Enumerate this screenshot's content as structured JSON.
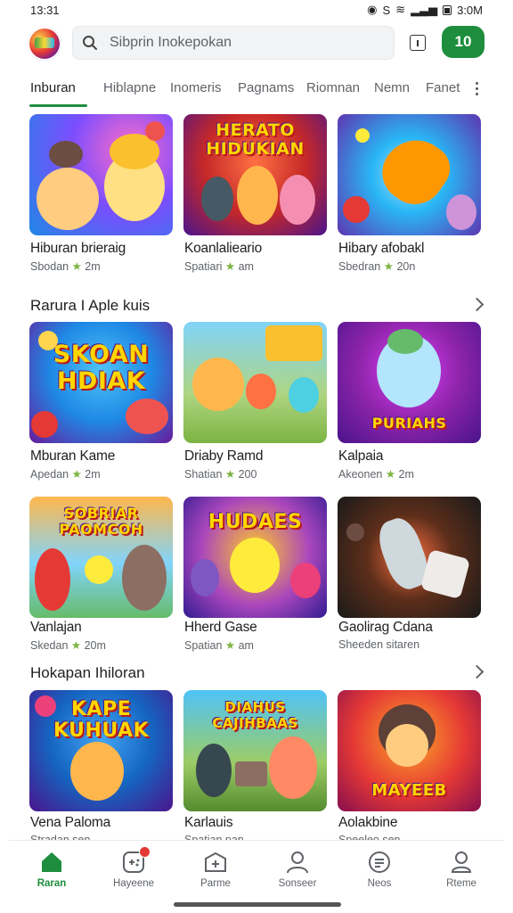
{
  "status_bar": {
    "time": "13:31",
    "right_text": "3:0M"
  },
  "header": {
    "search_placeholder": "Sibprin Inokepokan",
    "green_button_label": "10"
  },
  "tabs": [
    {
      "label": "Inburan",
      "active": true
    },
    {
      "label": "Hiblapne"
    },
    {
      "label": "Inomeris"
    },
    {
      "label": "Pagnams"
    },
    {
      "label": "Riomnan"
    },
    {
      "label": "Nemn"
    },
    {
      "label": "Fanet"
    }
  ],
  "row1": [
    {
      "title": "Hiburan brieraig",
      "meta_left": "Sbodan",
      "meta_right": "2m"
    },
    {
      "title": "Koanlalieario",
      "meta_left": "Spatiari",
      "meta_right": "am",
      "thumb_text": "HERATO HIDUKIAN"
    },
    {
      "title": "Hibary afobakl",
      "meta_left": "Sbedran",
      "meta_right": "20n"
    }
  ],
  "section2": {
    "title": "Rarura I Aple kuis"
  },
  "row2": [
    {
      "title": "Mburan Kame",
      "meta_left": "Apedan",
      "meta_right": "2m",
      "thumb_text": "SKOAN HDIAK"
    },
    {
      "title": "Driaby Ramd",
      "meta_left": "Shatian",
      "meta_right": "200"
    },
    {
      "title": "Kalpaia",
      "meta_left": "Akeonen",
      "meta_right": "2m",
      "thumb_text": "PURIAHS"
    }
  ],
  "row3": [
    {
      "title": "Vanlajan",
      "meta_left": "Skedan",
      "meta_right": "20m",
      "thumb_text": "SOBRIAR PAOMCOH"
    },
    {
      "title": "Hherd Gase",
      "meta_left": "Spatian",
      "meta_right": "am",
      "thumb_text": "HUDAES"
    },
    {
      "title": "Gaolirag Cdana",
      "meta_left": "Sheeden",
      "meta_right": "sitaren"
    }
  ],
  "section3": {
    "title": "Hokapan Ihiloran"
  },
  "row4": [
    {
      "title": "Vena Paloma",
      "meta_left": "Stradan",
      "meta_right": "sen",
      "thumb_text": "KAPE KUHUAK"
    },
    {
      "title": "Karlauis",
      "meta_left": "Spatian",
      "meta_right": "pan",
      "thumb_text": "DIAHUS CAJIHBAAS"
    },
    {
      "title": "Aolakbine",
      "meta_left": "Speeleo",
      "meta_right": "sen",
      "thumb_text": "MAYEEB"
    }
  ],
  "bottom_nav": [
    {
      "label": "Raran",
      "icon": "home-icon",
      "active": true
    },
    {
      "label": "Hayeene",
      "icon": "games-icon",
      "badge": true
    },
    {
      "label": "Parme",
      "icon": "apps-icon"
    },
    {
      "label": "Sonseer",
      "icon": "person-icon"
    },
    {
      "label": "Neos",
      "icon": "compass-icon"
    },
    {
      "label": "Rteme",
      "icon": "account-icon"
    }
  ],
  "colors": {
    "accent": "#1e8e3e",
    "badge": "#e53935"
  }
}
